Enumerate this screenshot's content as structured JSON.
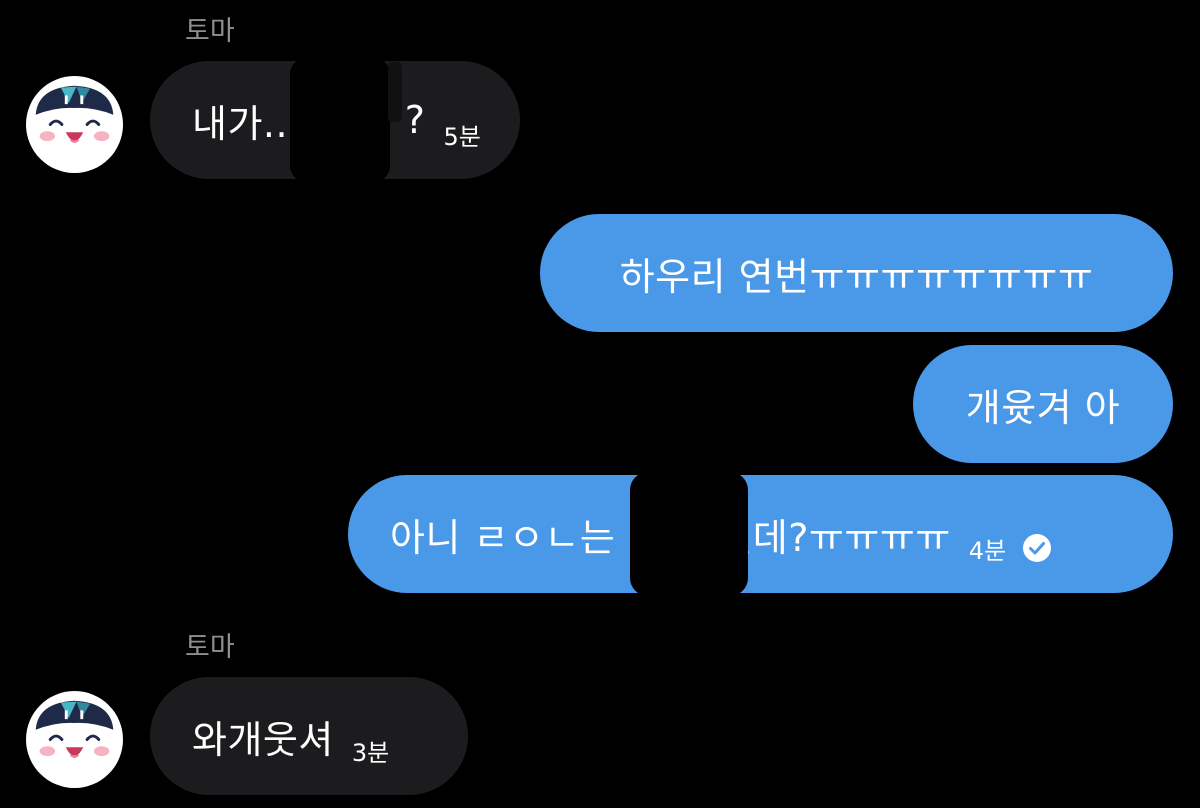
{
  "colors": {
    "background": "#000000",
    "incoming_bubble": "#1c1c1e",
    "outgoing_bubble": "#4a98e8",
    "sender_name": "#8e8e93"
  },
  "messages": [
    {
      "direction": "incoming",
      "sender": "토마",
      "avatar_icon": "toma-character-avatar",
      "text": "내가..1",
      "text_tail": "?",
      "time": "5분"
    },
    {
      "direction": "outgoing",
      "text": "하우리 연번ㅠㅠㅠㅠㅠㅠㅠㅠ"
    },
    {
      "direction": "outgoing",
      "text": "개윳겨 아"
    },
    {
      "direction": "outgoing",
      "text": "아니 ㄹㅇㄴ는",
      "text_tail": "인데?ㅠㅠㅠㅠ",
      "time": "4분",
      "status_icon": "read-check-icon"
    },
    {
      "direction": "incoming",
      "sender": "토마",
      "avatar_icon": "toma-character-avatar",
      "text": "와개웃셔",
      "time": "3분"
    }
  ]
}
